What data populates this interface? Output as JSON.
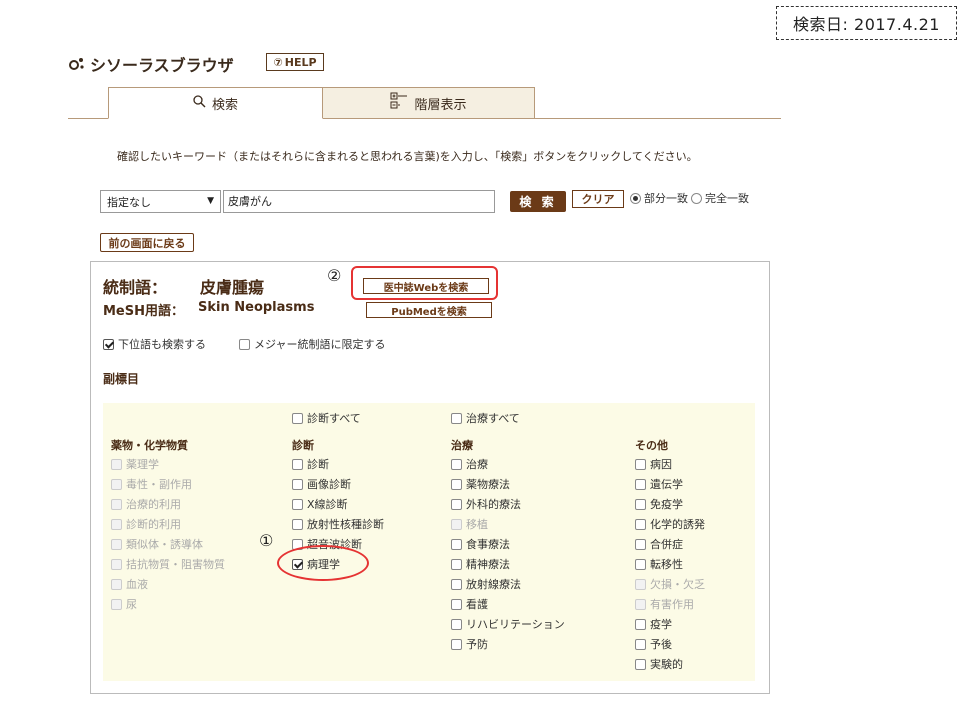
{
  "search_date": "検索日: 2017.4.21",
  "app": {
    "title": "シソーラスブラウザ",
    "help_label": "HELP",
    "help_icon": "question-circle-icon",
    "logo_icon": "thesaurus-logo-icon"
  },
  "tabs": [
    {
      "label": "検索",
      "icon": "magnifier-icon",
      "active": true
    },
    {
      "label": "階層表示",
      "icon": "tree-icon",
      "active": false
    }
  ],
  "instruction": "確認したいキーワード（またはそれらに含まれると思われる言葉)を入力し、「検索」ボタンをクリックしてください。",
  "search": {
    "select_value": "指定なし",
    "keyword": "皮膚がん",
    "search_label": "検 索",
    "clear_label": "クリア",
    "partial_label": "部分一致",
    "exact_label": "完全一致",
    "selected_match": "部分一致"
  },
  "back_label": "前の画面に戻る",
  "result": {
    "ct_label": "統制語：",
    "ct_value": "皮膚腫瘍",
    "mesh_label": "MeSH用語：",
    "mesh_value": "Skin Neoplasms",
    "ichushi_btn": "医中誌Webを検索",
    "pubmed_btn": "PubMedを検索",
    "include_lower": "下位語も検索する",
    "include_lower_checked": true,
    "major_only": "メジャー統制語に限定する",
    "major_only_checked": false,
    "subheading_title": "副標目"
  },
  "annotations": {
    "one": "①",
    "two": "②"
  },
  "subheadings": {
    "diag_all": "診断すべて",
    "treat_all": "治療すべて",
    "col1": {
      "head": "薬物・化学物質",
      "items": [
        {
          "label": "薬理学",
          "disabled": true,
          "checked": false
        },
        {
          "label": "毒性・副作用",
          "disabled": true,
          "checked": false
        },
        {
          "label": "治療的利用",
          "disabled": true,
          "checked": false
        },
        {
          "label": "診断的利用",
          "disabled": true,
          "checked": false
        },
        {
          "label": "類似体・誘導体",
          "disabled": true,
          "checked": false
        },
        {
          "label": "拮抗物質・阻害物質",
          "disabled": true,
          "checked": false
        },
        {
          "label": "血液",
          "disabled": true,
          "checked": false
        },
        {
          "label": "尿",
          "disabled": true,
          "checked": false
        }
      ]
    },
    "col2": {
      "head": "診断",
      "items": [
        {
          "label": "診断",
          "disabled": false,
          "checked": false
        },
        {
          "label": "画像診断",
          "disabled": false,
          "checked": false
        },
        {
          "label": "X線診断",
          "disabled": false,
          "checked": false
        },
        {
          "label": "放射性核種診断",
          "disabled": false,
          "checked": false
        },
        {
          "label": "超音波診断",
          "disabled": false,
          "checked": false
        },
        {
          "label": "病理学",
          "disabled": false,
          "checked": true
        }
      ]
    },
    "col3": {
      "head": "治療",
      "items": [
        {
          "label": "治療",
          "disabled": false,
          "checked": false
        },
        {
          "label": "薬物療法",
          "disabled": false,
          "checked": false
        },
        {
          "label": "外科的療法",
          "disabled": false,
          "checked": false
        },
        {
          "label": "移植",
          "disabled": true,
          "checked": false
        },
        {
          "label": "食事療法",
          "disabled": false,
          "checked": false
        },
        {
          "label": "精神療法",
          "disabled": false,
          "checked": false
        },
        {
          "label": "放射線療法",
          "disabled": false,
          "checked": false
        },
        {
          "label": "看護",
          "disabled": false,
          "checked": false
        },
        {
          "label": "リハビリテーション",
          "disabled": false,
          "checked": false
        },
        {
          "label": "予防",
          "disabled": false,
          "checked": false
        }
      ]
    },
    "col4": {
      "head": "その他",
      "items": [
        {
          "label": "病因",
          "disabled": false,
          "checked": false
        },
        {
          "label": "遺伝学",
          "disabled": false,
          "checked": false
        },
        {
          "label": "免疫学",
          "disabled": false,
          "checked": false
        },
        {
          "label": "化学的誘発",
          "disabled": false,
          "checked": false
        },
        {
          "label": "合併症",
          "disabled": false,
          "checked": false
        },
        {
          "label": "転移性",
          "disabled": false,
          "checked": false
        },
        {
          "label": "欠損・欠乏",
          "disabled": true,
          "checked": false
        },
        {
          "label": "有害作用",
          "disabled": true,
          "checked": false
        },
        {
          "label": "疫学",
          "disabled": false,
          "checked": false
        },
        {
          "label": "予後",
          "disabled": false,
          "checked": false
        },
        {
          "label": "実験的",
          "disabled": false,
          "checked": false
        }
      ]
    }
  },
  "colors": {
    "brand_brown": "#6b3a17",
    "annotation_red": "#e53333",
    "subheading_bg": "#fcfbe6"
  }
}
